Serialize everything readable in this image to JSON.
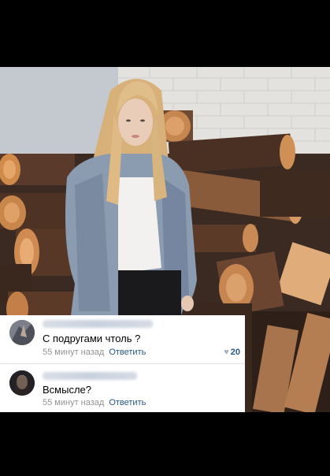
{
  "comments": [
    {
      "text": "С подругами чтоль ?",
      "time": "55 минут назад",
      "reply_label": "Ответить",
      "likes": "20"
    },
    {
      "text": "Всмысле?",
      "time": "55 минут назад",
      "reply_label": "Ответить"
    }
  ],
  "icons": {
    "like": "heart-icon"
  },
  "colors": {
    "link": "#2a5885",
    "meta": "#939393",
    "background": "#000000"
  }
}
